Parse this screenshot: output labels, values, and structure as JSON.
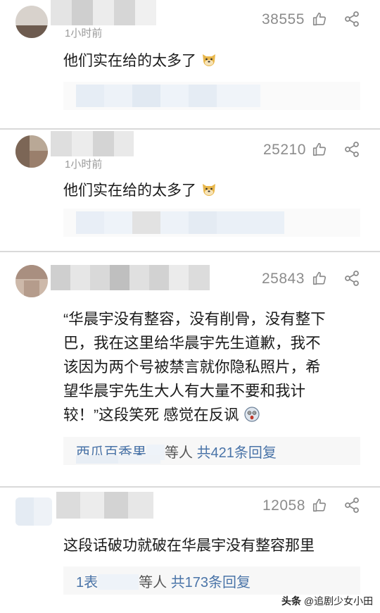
{
  "comments": [
    {
      "time_label": "1小时前",
      "likes": "38555",
      "text": "他们实在给的太多了",
      "emoji": "doge-emoji"
    },
    {
      "time_label": "1小时前",
      "likes": "25210",
      "text": "他们实在给的太多了",
      "emoji": "doge-emoji"
    },
    {
      "likes": "25843",
      "text_lines": [
        "“华晨宇没有整容，没有削骨，没有整下",
        "巴，我在这里给华晨宇先生道歉，我不",
        "该因为两个号被禁言就你隐私照片，希",
        "望华晨宇先生大人有大量不要和我计",
        "较！”这段笑死 感觉在反讽"
      ],
      "emoji": "scared-emoji",
      "reply_prefix": "西瓜百香果",
      "reply_middle": "等人",
      "reply_link": "共421条回复"
    },
    {
      "likes": "12058",
      "text": "这段话破功就破在华晨宇没有整容那里",
      "reply_prefix": "1表",
      "reply_middle": "等人",
      "reply_link": "共173条回复"
    }
  ],
  "watermark": {
    "head": "头条",
    "author": "@追剧少女小田"
  },
  "icons": {
    "like": "thumb-up-icon",
    "share": "share-icon"
  },
  "colors": {
    "link": "#4a74a8",
    "meta": "#8c8c8c",
    "reply_bg": "#f7f7f7"
  }
}
